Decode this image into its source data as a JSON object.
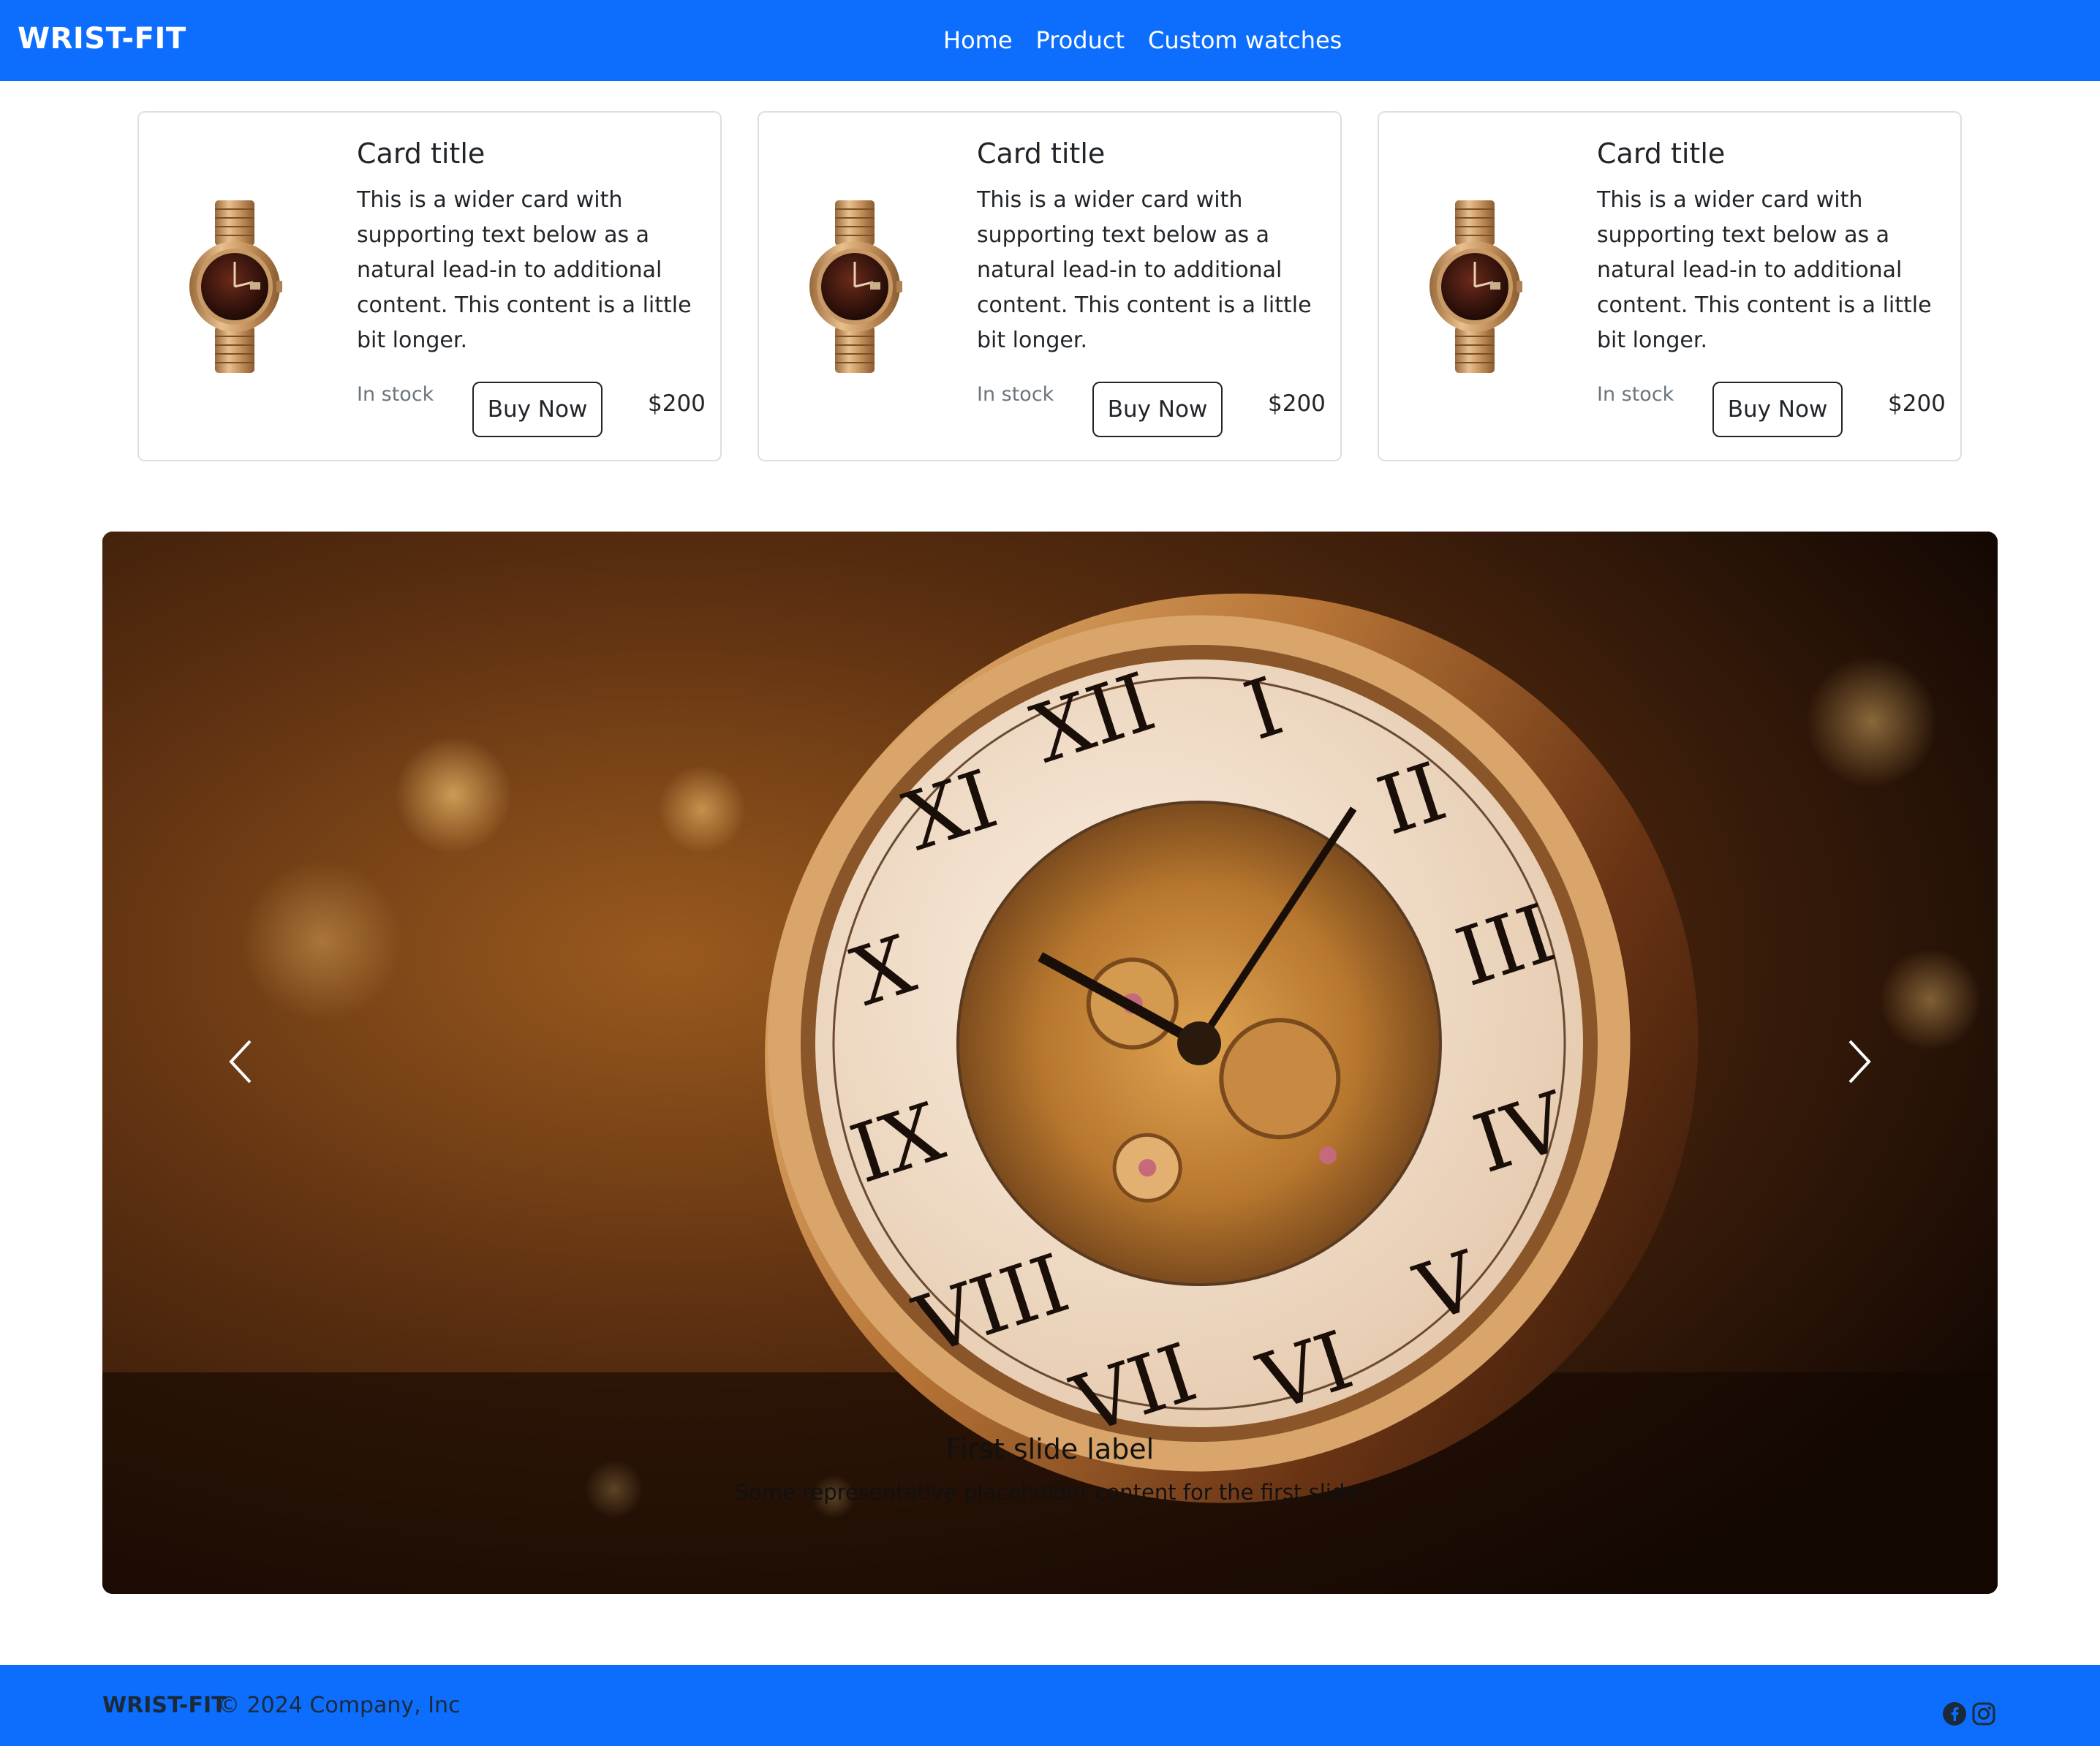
{
  "navbar": {
    "brand": "WRIST-FIT",
    "links": [
      "Home",
      "Product",
      "Custom watches"
    ],
    "background": "#0d6efd"
  },
  "cards": [
    {
      "title": "Card title",
      "text": "This is a wider card with supporting text below as a natural lead-in to additional content. This content is a little bit longer.",
      "stock": "In stock",
      "button": "Buy Now",
      "price": "$200",
      "image_icon": "gold-wristwatch-image"
    },
    {
      "title": "Card title",
      "text": "This is a wider card with supporting text below as a natural lead-in to additional content. This content is a little bit longer.",
      "stock": "In stock",
      "button": "Buy Now",
      "price": "$200",
      "image_icon": "gold-wristwatch-image"
    },
    {
      "title": "Card title",
      "text": "This is a wider card with supporting text below as a natural lead-in to additional content. This content is a little bit longer.",
      "stock": "In stock",
      "button": "Buy Now",
      "price": "$200",
      "image_icon": "gold-wristwatch-image"
    }
  ],
  "carousel": {
    "image_icon": "pocket-watch-image",
    "caption_title": "First slide label",
    "caption_text": "Some representative placeholder content for the first slide.",
    "prev_icon": "chevron-left-icon",
    "next_icon": "chevron-right-icon",
    "active_slide": 1,
    "slide_count": 3
  },
  "footer": {
    "brand": "WRIST-FIT",
    "copyright": "© 2024 Company, Inc",
    "icons": [
      "facebook-icon",
      "instagram-icon"
    ],
    "background": "#0d6efd"
  }
}
